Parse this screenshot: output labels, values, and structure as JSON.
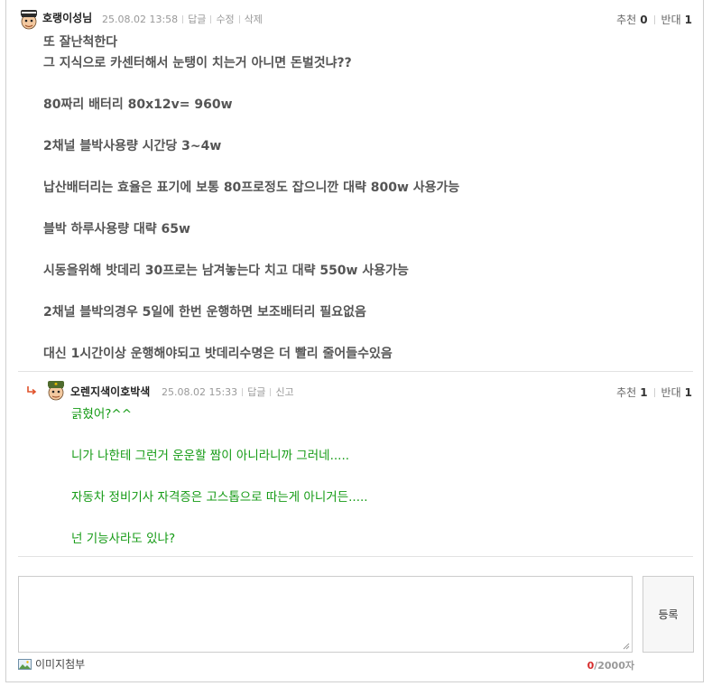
{
  "comment1": {
    "nickname": "호랭이성님",
    "date": "25.08.02 13:58",
    "actions": [
      "답글",
      "수정",
      "삭제"
    ],
    "recommend_label": "추천",
    "recommend_count": "0",
    "oppose_label": "반대",
    "oppose_count": "1",
    "lines": [
      "또 잘난척한다",
      "그 지식으로 카센터해서 눈탱이 치는거 아니면 돈벌것냐??",
      "80짜리 배터리 80x12v= 960w",
      "2채널 블박사용량 시간당 3~4w",
      "납산배터리는 효율은 표기에 보통 80프로정도 잡으니깐 대략 800w 사용가능",
      "블박 하루사용량 대략 65w",
      "시동을위해 밧데리 30프로는 남겨놓는다 치고 대략 550w 사용가능",
      "2채널 블박의경우 5일에 한번 운행하면 보조배터리 필요없음",
      "대신 1시간이상 운행해야되고 밧데리수명은 더 빨리 줄어들수있음"
    ]
  },
  "comment2": {
    "nickname": "오렌지색이호박색",
    "date": "25.08.02 15:33",
    "actions": [
      "답글",
      "신고"
    ],
    "recommend_label": "추천",
    "recommend_count": "1",
    "oppose_label": "반대",
    "oppose_count": "1",
    "lines": [
      "긁혔어?^^",
      "니가 나한테 그런거 운운할 짬이 아니라니까 그러네.....",
      "자동차 정비기사 자격증은 고스톱으로 따는게 아니거든.....",
      "넌 기능사라도 있냐?"
    ]
  },
  "editor": {
    "submit_label": "등록",
    "attach_label": "이미지첨부",
    "char_count": "0",
    "char_max": "/2000자"
  }
}
